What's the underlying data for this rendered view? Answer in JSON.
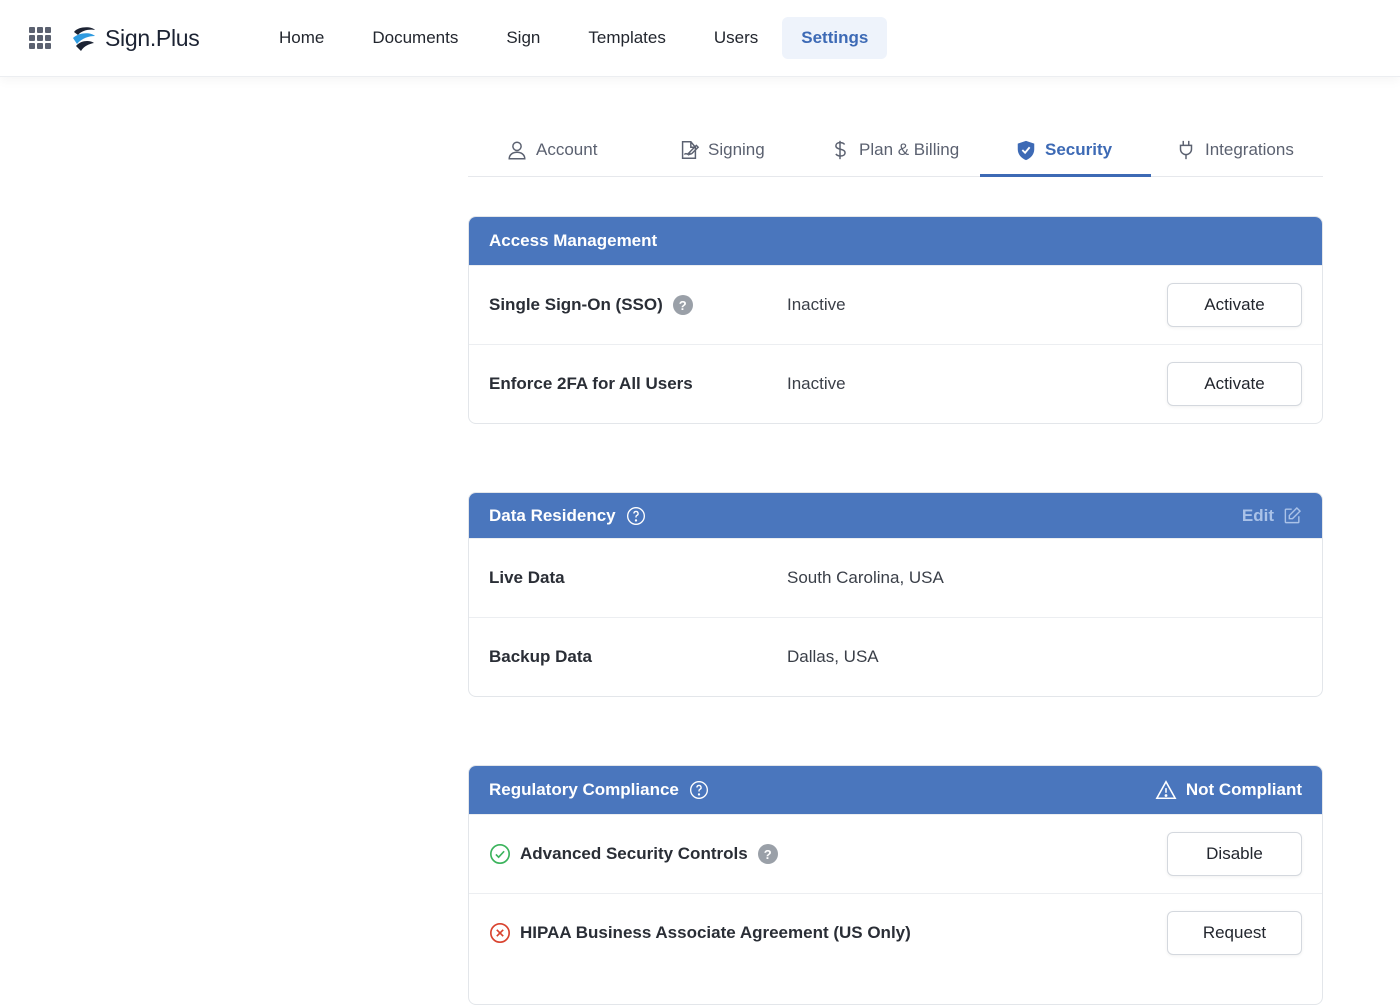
{
  "brand": {
    "name": "Sign.Plus"
  },
  "nav": {
    "items": [
      {
        "label": "Home"
      },
      {
        "label": "Documents"
      },
      {
        "label": "Sign"
      },
      {
        "label": "Templates"
      },
      {
        "label": "Users"
      },
      {
        "label": "Settings",
        "active": true
      }
    ]
  },
  "tabs": [
    {
      "label": "Account",
      "icon": "user-icon"
    },
    {
      "label": "Signing",
      "icon": "signing-icon"
    },
    {
      "label": "Plan & Billing",
      "icon": "dollar-icon"
    },
    {
      "label": "Security",
      "icon": "shield-icon",
      "active": true
    },
    {
      "label": "Integrations",
      "icon": "plug-icon"
    }
  ],
  "access": {
    "title": "Access Management",
    "rows": [
      {
        "label": "Single Sign-On (SSO)",
        "status": "Inactive",
        "action": "Activate",
        "help": "?"
      },
      {
        "label": "Enforce 2FA for All Users",
        "status": "Inactive",
        "action": "Activate"
      }
    ]
  },
  "residency": {
    "title": "Data Residency",
    "edit_label": "Edit",
    "rows": [
      {
        "label": "Live Data",
        "value": "South Carolina, USA"
      },
      {
        "label": "Backup Data",
        "value": "Dallas, USA"
      }
    ]
  },
  "compliance": {
    "title": "Regulatory Compliance",
    "status": "Not Compliant",
    "rows": [
      {
        "label": "Advanced Security Controls",
        "state": "enabled",
        "action": "Disable",
        "help": "?"
      },
      {
        "label": "HIPAA Business Associate Agreement (US Only)",
        "state": "missing",
        "action": "Request"
      }
    ]
  },
  "colors": {
    "accent": "#4a76bd",
    "nav_active_bg": "#eef3fb",
    "nav_active_text": "#3d6ab5",
    "ok": "#3bb35c",
    "error": "#d9432f"
  }
}
